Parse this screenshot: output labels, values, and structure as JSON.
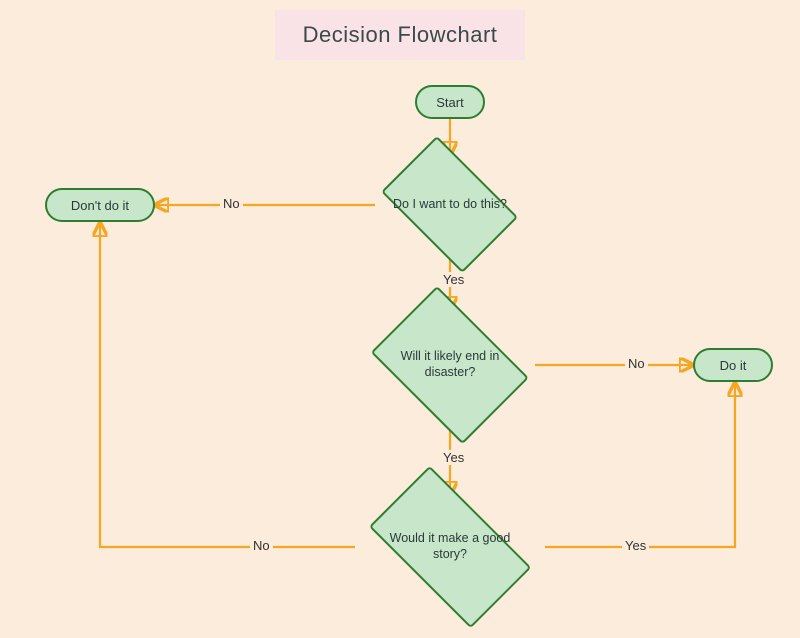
{
  "title": "Decision Flowchart",
  "nodes": {
    "start": {
      "label": "Start"
    },
    "dont": {
      "label": "Don't do it"
    },
    "doit": {
      "label": "Do it"
    },
    "q_want": {
      "label": "Do I want to do this?"
    },
    "q_disaster": {
      "label": "Will it likely end in disaster?"
    },
    "q_story": {
      "label": "Would it make a good story?"
    }
  },
  "edges": {
    "yes": "Yes",
    "no": "No"
  },
  "colors": {
    "background": "#fbecdb",
    "title_bg": "#f9e3e7",
    "node_fill": "#c8e6c9",
    "node_stroke": "#2e7d32",
    "edge": "#f5a623"
  }
}
